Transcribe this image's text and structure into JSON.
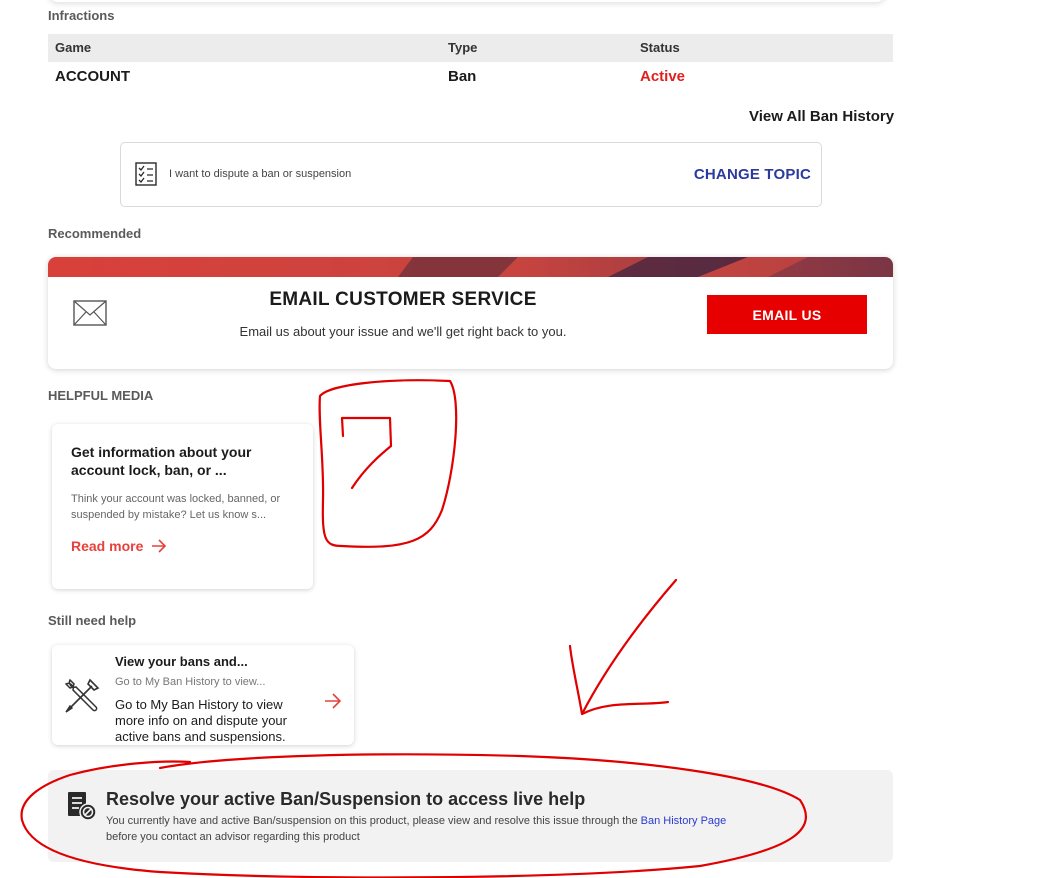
{
  "infractions": {
    "label": "Infractions",
    "columns": {
      "game": "Game",
      "type": "Type",
      "status": "Status"
    },
    "rows": [
      {
        "game": "ACCOUNT",
        "type": "Ban",
        "status": "Active"
      }
    ],
    "view_all": "View All Ban History"
  },
  "topic": {
    "text": "I want to dispute a ban or suspension",
    "change": "CHANGE TOPIC"
  },
  "recommended": {
    "label": "Recommended",
    "title": "EMAIL CUSTOMER SERVICE",
    "subtitle": "Email us about your issue and we'll get right back to you.",
    "button": "EMAIL US"
  },
  "helpful_media": {
    "label": "HELPFUL MEDIA",
    "title": "Get information about your account lock, ban, or ...",
    "description": "Think your account was locked, banned, or suspended by mistake? Let us know s...",
    "read_more": "Read more"
  },
  "still_need_help": {
    "label": "Still need help",
    "title": "View your bans and...",
    "subtitle": "Go to My Ban History to view...",
    "description": "Go to My Ban History to view more info on and dispute your active bans and suspensions."
  },
  "resolve": {
    "title": "Resolve your active Ban/Suspension to access live help",
    "text_before": "You currently have and active Ban/suspension on this product, please view and resolve this issue through the ",
    "link": "Ban History Page",
    "text_after": " before you contact an advisor regarding this product"
  },
  "colors": {
    "accent_red": "#e60000",
    "status_red": "#e02020",
    "link_blue": "#2b3a9e",
    "annotation_red": "#e00000"
  },
  "icons": [
    "checklist-icon",
    "envelope-icon",
    "arrow-right-icon",
    "tools-icon",
    "document-ban-icon"
  ]
}
